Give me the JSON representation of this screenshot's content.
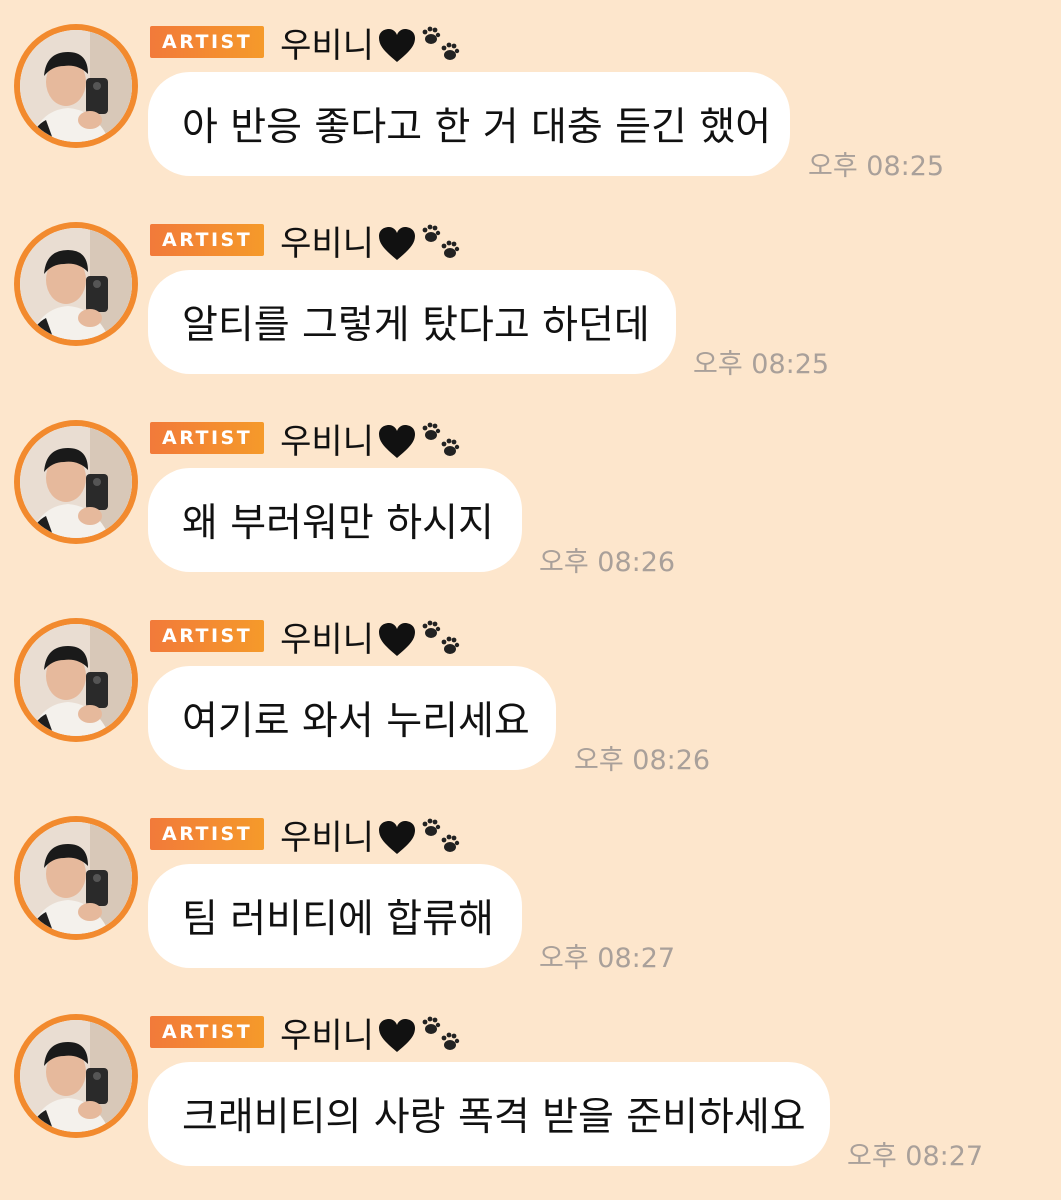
{
  "colors": {
    "background": "#fde6cc",
    "badge_start": "#f27a3a",
    "badge_end": "#f59a2a",
    "avatar_ring": "#f28a2e",
    "bubble": "#ffffff",
    "timestamp": "#a9a09a"
  },
  "messages": [
    {
      "badge": "ARTIST",
      "name": "우비니",
      "text": "아 반응 좋다고 한 거 대충 듣긴 했어",
      "time": "오후 08:25"
    },
    {
      "badge": "ARTIST",
      "name": "우비니",
      "text": "알티를 그렇게 탔다고 하던데",
      "time": "오후 08:25"
    },
    {
      "badge": "ARTIST",
      "name": "우비니",
      "text": "왜 부러워만 하시지",
      "time": "오후 08:26"
    },
    {
      "badge": "ARTIST",
      "name": "우비니",
      "text": "여기로 와서 누리세요",
      "time": "오후 08:26"
    },
    {
      "badge": "ARTIST",
      "name": "우비니",
      "text": "팀 러비티에 합류해",
      "time": "오후 08:27"
    },
    {
      "badge": "ARTIST",
      "name": "우비니",
      "text": "크래비티의 사랑 폭격 받을 준비하세요",
      "time": "오후 08:27"
    }
  ]
}
